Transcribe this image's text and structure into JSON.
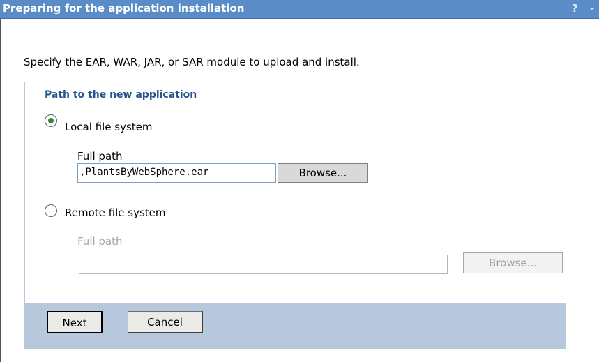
{
  "dialog": {
    "title": "Preparing for the application installation",
    "help_label": "?",
    "minimize_label": "-"
  },
  "instruction": "Specify the EAR, WAR, JAR, or SAR module to upload and install.",
  "path_group": {
    "legend": "Path to the new application",
    "local": {
      "label": "Local file system",
      "selected": true,
      "full_path_label": "Full path",
      "full_path_value": ",PlantsByWebSphere.ear",
      "browse_label": "Browse..."
    },
    "remote": {
      "label": "Remote file system",
      "selected": false,
      "full_path_label": "Full path",
      "full_path_value": "",
      "browse_label": "Browse..."
    }
  },
  "footer": {
    "next_label": "Next",
    "cancel_label": "Cancel"
  },
  "colors": {
    "title_bar": "#5a8dc8",
    "legend_text": "#24558f",
    "footer_bar": "#b8c8dc",
    "radio_selected": "#2f8b2f"
  }
}
